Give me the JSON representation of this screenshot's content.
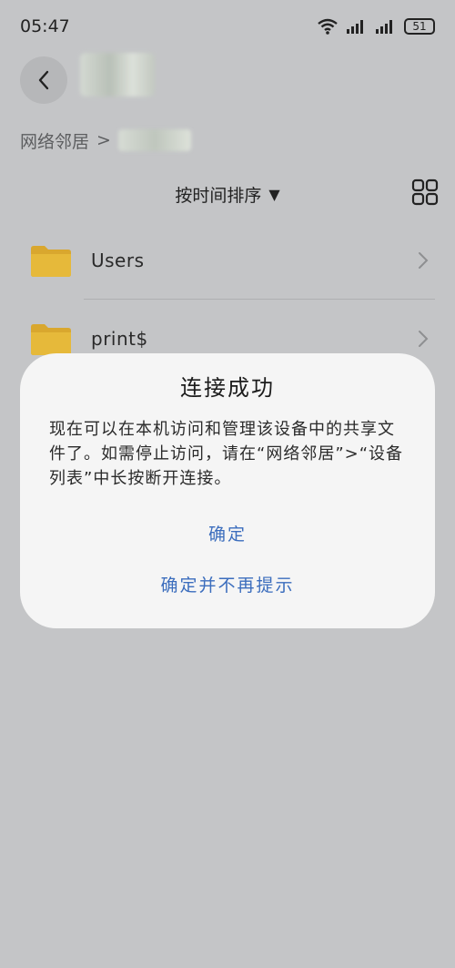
{
  "status_bar": {
    "time": "05:47",
    "battery": "51"
  },
  "header": {
    "back_icon": "chevron-left-icon"
  },
  "breadcrumb": {
    "root": "网络邻居",
    "separator": ">"
  },
  "sort": {
    "label": "按时间排序",
    "arrow": "▼"
  },
  "files": [
    {
      "name": "Users",
      "icon": "folder-icon"
    },
    {
      "name": "print$",
      "icon": "folder-icon"
    }
  ],
  "dialog": {
    "title": "连接成功",
    "message": "现在可以在本机访问和管理该设备中的共享文件了。如需停止访问，请在“网络邻居”>“设备列表”中长按断开连接。",
    "confirm": "确定",
    "confirm_no_remind": "确定并不再提示"
  },
  "colors": {
    "background": "#c4c5c7",
    "dialog_bg": "#f5f5f5",
    "accent": "#3b6dbd",
    "folder": "#e6b93a"
  }
}
